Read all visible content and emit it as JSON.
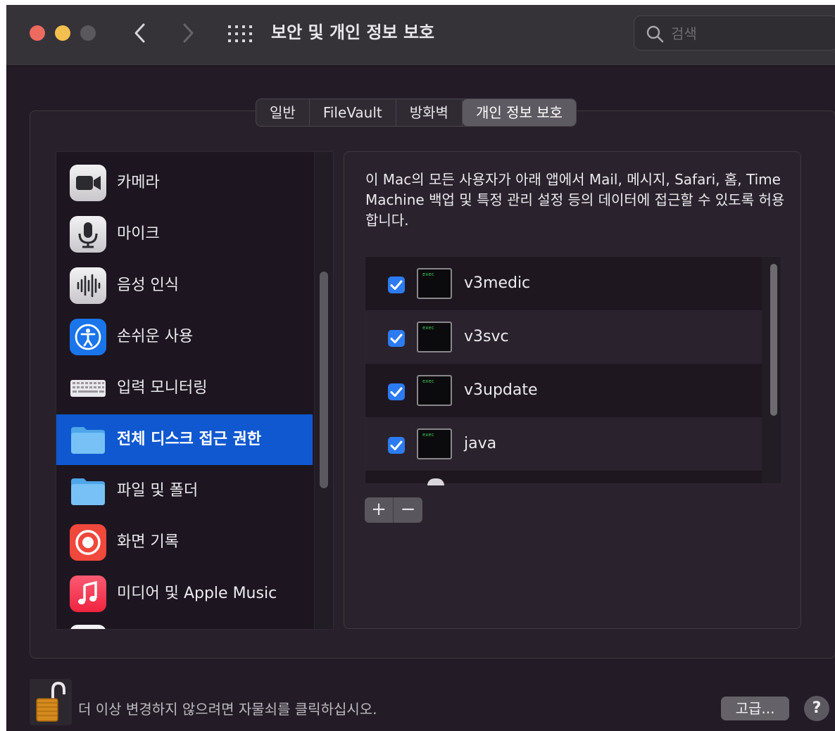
{
  "window": {
    "title": "보안 및 개인 정보 보호",
    "search_placeholder": "검색"
  },
  "tabs": [
    {
      "label": "일반",
      "active": false
    },
    {
      "label": "FileVault",
      "active": false
    },
    {
      "label": "방화벽",
      "active": false
    },
    {
      "label": "개인 정보 보호",
      "active": true
    }
  ],
  "sidebar": {
    "items": [
      {
        "label": "카메라",
        "icon": "camera-icon"
      },
      {
        "label": "마이크",
        "icon": "microphone-icon"
      },
      {
        "label": "음성 인식",
        "icon": "speech-recognition-icon"
      },
      {
        "label": "손쉬운 사용",
        "icon": "accessibility-icon"
      },
      {
        "label": "입력 모니터링",
        "icon": "keyboard-icon"
      },
      {
        "label": "전체 디스크 접근 권한",
        "icon": "folder-icon",
        "selected": true
      },
      {
        "label": "파일 및 폴더",
        "icon": "folder-icon"
      },
      {
        "label": "화면 기록",
        "icon": "screen-recording-icon"
      },
      {
        "label": "미디어 및 Apple Music",
        "icon": "music-icon"
      }
    ]
  },
  "detail": {
    "description": "이 Mac의 모든 사용자가 아래 앱에서 Mail, 메시지, Safari, 홈, Time Machine 백업 및 특정 관리 설정 등의 데이터에 접근할 수 있도록 허용합니다.",
    "apps": [
      {
        "name": "v3medic",
        "checked": true
      },
      {
        "name": "v3svc",
        "checked": true
      },
      {
        "name": "v3update",
        "checked": true
      },
      {
        "name": "java",
        "checked": true
      }
    ],
    "add_label": "+",
    "remove_label": "−"
  },
  "footer": {
    "lock_text": "더 이상 변경하지 않으려면 자물쇠를 클릭하십시오.",
    "advanced_label": "고급...",
    "help_label": "?"
  },
  "colors": {
    "accent": "#0f58d0",
    "checkbox": "#2c7bf2"
  }
}
